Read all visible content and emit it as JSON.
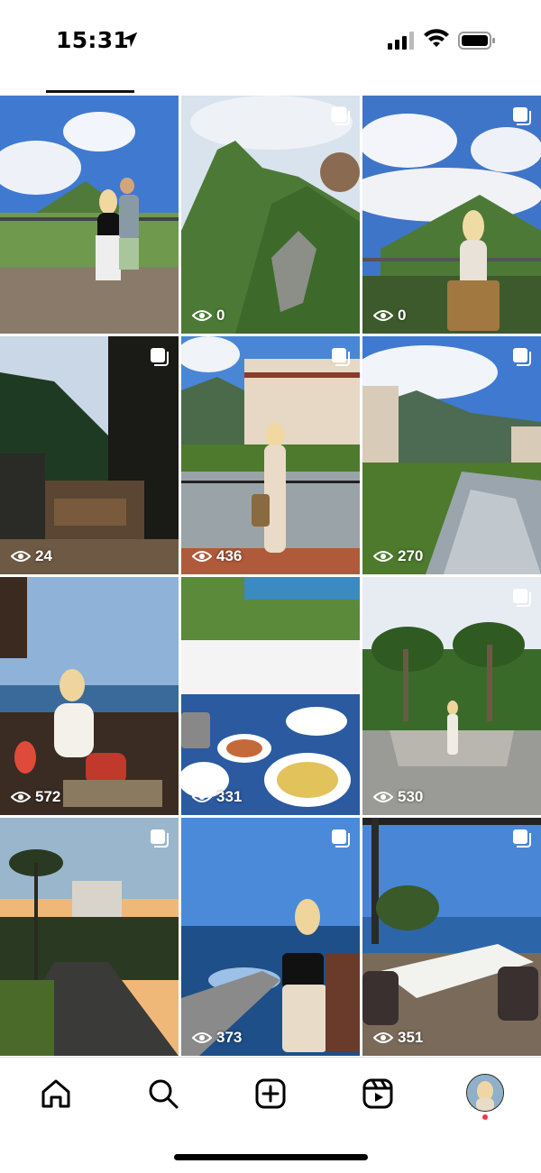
{
  "status_bar": {
    "time": "15:31",
    "icons": [
      "location-arrow-icon",
      "signal-icon",
      "wifi-icon",
      "battery-icon"
    ]
  },
  "grid": {
    "posts": [
      {
        "views": "",
        "multi": false,
        "scene": "mountain balcony couple"
      },
      {
        "views": "0",
        "multi": true,
        "scene": "green mountain peak"
      },
      {
        "views": "0",
        "multi": true,
        "scene": "woman on balcony clouds"
      },
      {
        "views": "24",
        "multi": true,
        "scene": "wooden terrace forest"
      },
      {
        "views": "436",
        "multi": true,
        "scene": "woman at river hotel"
      },
      {
        "views": "270",
        "multi": true,
        "scene": "mountain river"
      },
      {
        "views": "572",
        "multi": false,
        "scene": "woman at sea cafe"
      },
      {
        "views": "331",
        "multi": false,
        "scene": "breakfast plates"
      },
      {
        "views": "530",
        "multi": true,
        "scene": "palm garden woman"
      },
      {
        "views": "",
        "multi": true,
        "scene": "sunset road palms"
      },
      {
        "views": "373",
        "multi": true,
        "scene": "woman by sea"
      },
      {
        "views": "351",
        "multi": true,
        "scene": "sea terrace table"
      }
    ]
  },
  "colors": {
    "accent_dot": "#ff3040",
    "sky": "#4a86d6",
    "grass": "#4d7a2c"
  },
  "nav": {
    "items": [
      "home-icon",
      "search-icon",
      "create-icon",
      "reels-icon",
      "profile-avatar"
    ]
  }
}
